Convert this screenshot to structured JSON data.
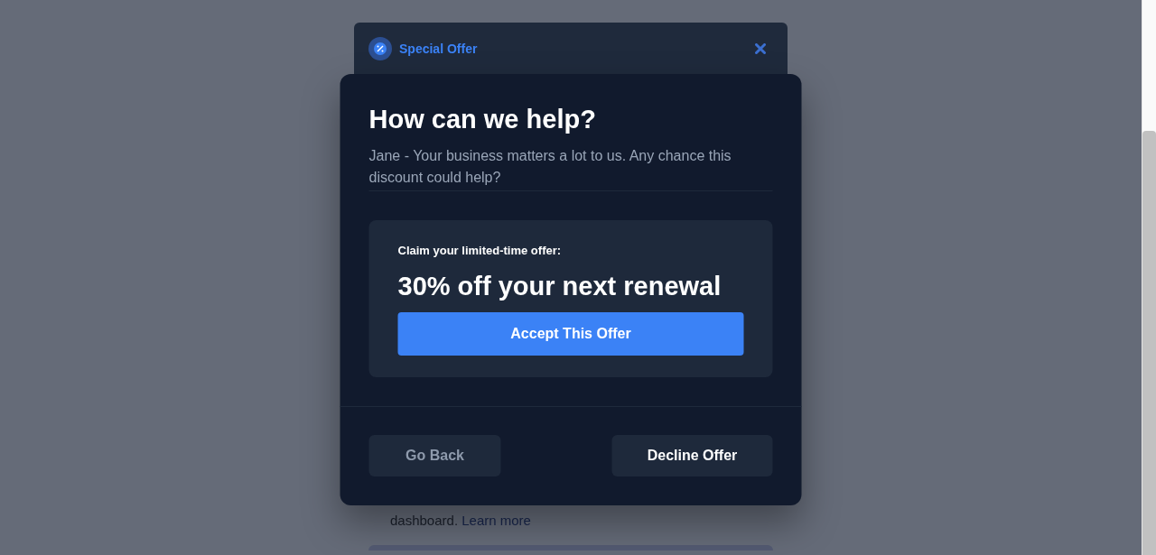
{
  "background_card": {
    "title": "Special Offer",
    "note": "dashboard.",
    "link": "Learn more"
  },
  "modal": {
    "title": "How can we help?",
    "message": "Jane - Your business matters a lot to us. Any chance this discount could help?",
    "offer": {
      "label": "Claim your limited-time offer:",
      "headline": "30% off your next renewal",
      "button": "Accept This Offer"
    },
    "buttons": [
      {
        "label": "Go Back",
        "kind": "secondary"
      },
      {
        "label": "Decline Offer",
        "kind": "primary"
      }
    ]
  }
}
